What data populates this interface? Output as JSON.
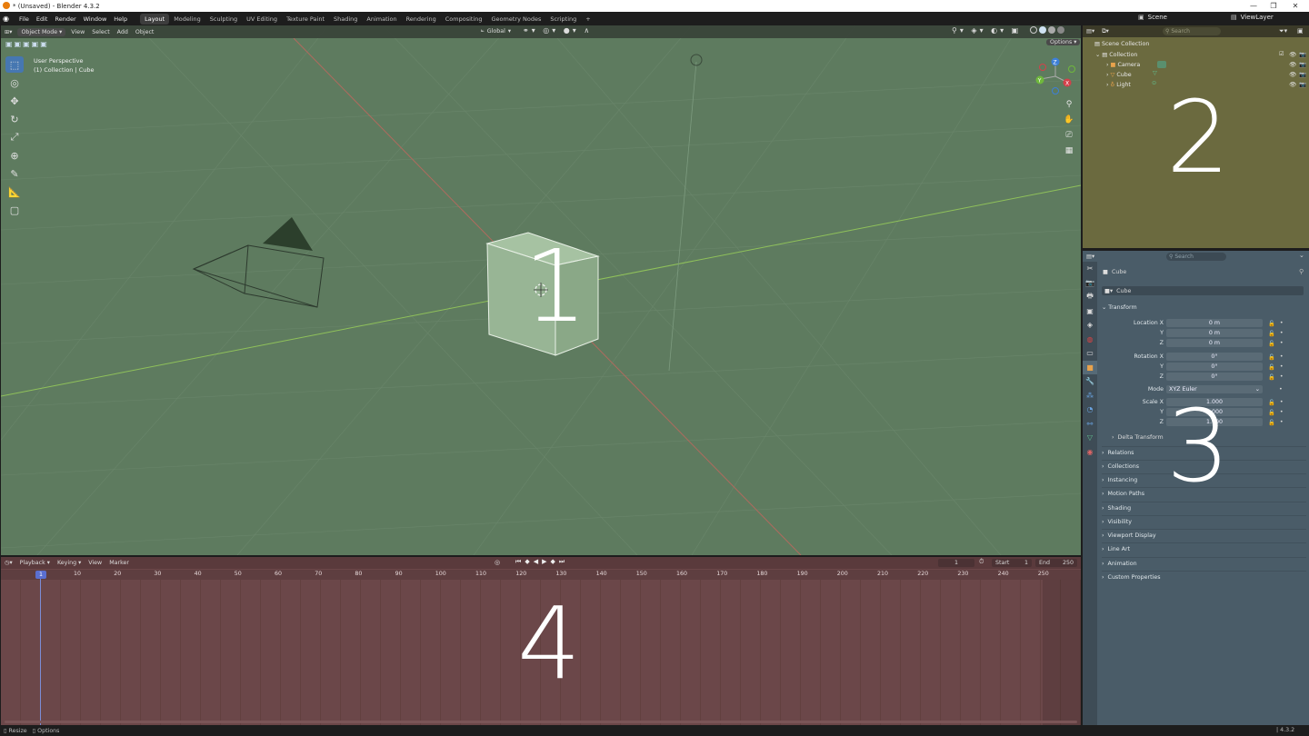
{
  "window": {
    "title": "* (Unsaved) - Blender 4.3.2",
    "controls": [
      "—",
      "❐",
      "✕"
    ]
  },
  "menubar": {
    "menus": [
      "File",
      "Edit",
      "Render",
      "Window",
      "Help"
    ],
    "workspaces": [
      "Layout",
      "Modeling",
      "Sculpting",
      "UV Editing",
      "Texture Paint",
      "Shading",
      "Animation",
      "Rendering",
      "Compositing",
      "Geometry Nodes",
      "Scripting"
    ],
    "active_workspace": "Layout",
    "add_workspace": "+",
    "scene_label": "Scene",
    "viewlayer_label": "ViewLayer"
  },
  "viewport": {
    "mode": "Object Mode",
    "menus": [
      "View",
      "Select",
      "Add",
      "Object"
    ],
    "orientation": "Global",
    "options_label": "Options",
    "info_line1": "User Perspective",
    "info_line2": "(1) Collection | Cube",
    "area_number": "1",
    "gizmo": {
      "x": "X",
      "y": "Y",
      "z": "Z"
    }
  },
  "outliner": {
    "search_placeholder": "Search",
    "scene_collection": "Scene Collection",
    "collection": "Collection",
    "items": [
      "Camera",
      "Cube",
      "Light"
    ],
    "area_number": "2"
  },
  "properties": {
    "search_placeholder": "Search",
    "object_name": "Cube",
    "object_field": "Cube",
    "transform_title": "Transform",
    "location_label": "Location X",
    "location": [
      "0 m",
      "0 m",
      "0 m"
    ],
    "rotation_label": "Rotation X",
    "rotation": [
      "0°",
      "0°",
      "0°"
    ],
    "mode_label": "Mode",
    "mode_value": "XYZ Euler",
    "scale_label": "Scale X",
    "scale": [
      "1.000",
      "1.000",
      "1.000"
    ],
    "axis_y": "Y",
    "axis_z": "Z",
    "delta_transform": "Delta Transform",
    "panels": [
      "Relations",
      "Collections",
      "Instancing",
      "Motion Paths",
      "Shading",
      "Visibility",
      "Viewport Display",
      "Line Art",
      "Animation",
      "Custom Properties"
    ],
    "area_number": "3"
  },
  "timeline": {
    "menus": [
      "Playback",
      "Keying",
      "View",
      "Marker"
    ],
    "current_frame": "1",
    "start_label": "Start",
    "start_value": "1",
    "end_label": "End",
    "end_value": "250",
    "ruler": [
      "10",
      "20",
      "30",
      "40",
      "50",
      "60",
      "70",
      "80",
      "90",
      "100",
      "110",
      "120",
      "130",
      "140",
      "150",
      "160",
      "170",
      "180",
      "190",
      "200",
      "210",
      "220",
      "230",
      "240",
      "250"
    ],
    "playhead_label": "1",
    "area_number": "4"
  },
  "statusbar": {
    "left1": "Resize",
    "left2": "Options",
    "version": "4.3.2"
  }
}
